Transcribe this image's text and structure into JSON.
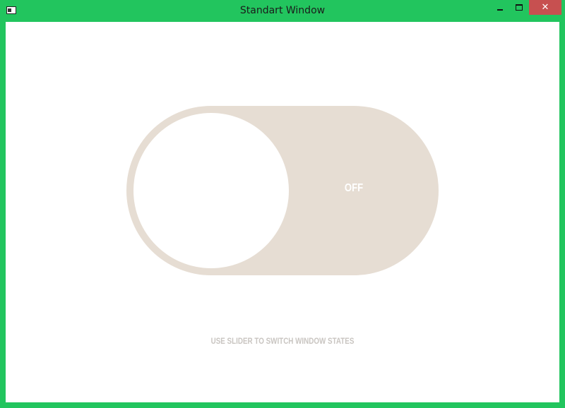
{
  "window": {
    "title": "Standart Window",
    "frame_color": "#22c55e",
    "close_glyph": "✕",
    "icons": {
      "app": "app-window-icon",
      "minimize": "minimize-icon",
      "maximize": "maximize-icon",
      "close": "close-icon"
    }
  },
  "toggle": {
    "state_label": "OFF",
    "state": "off",
    "track_color": "#e6ddd3",
    "knob_color": "#ffffff"
  },
  "hint": {
    "text": "USE SLIDER TO SWITCH WINDOW STATES",
    "color": "#c9c5c1"
  }
}
